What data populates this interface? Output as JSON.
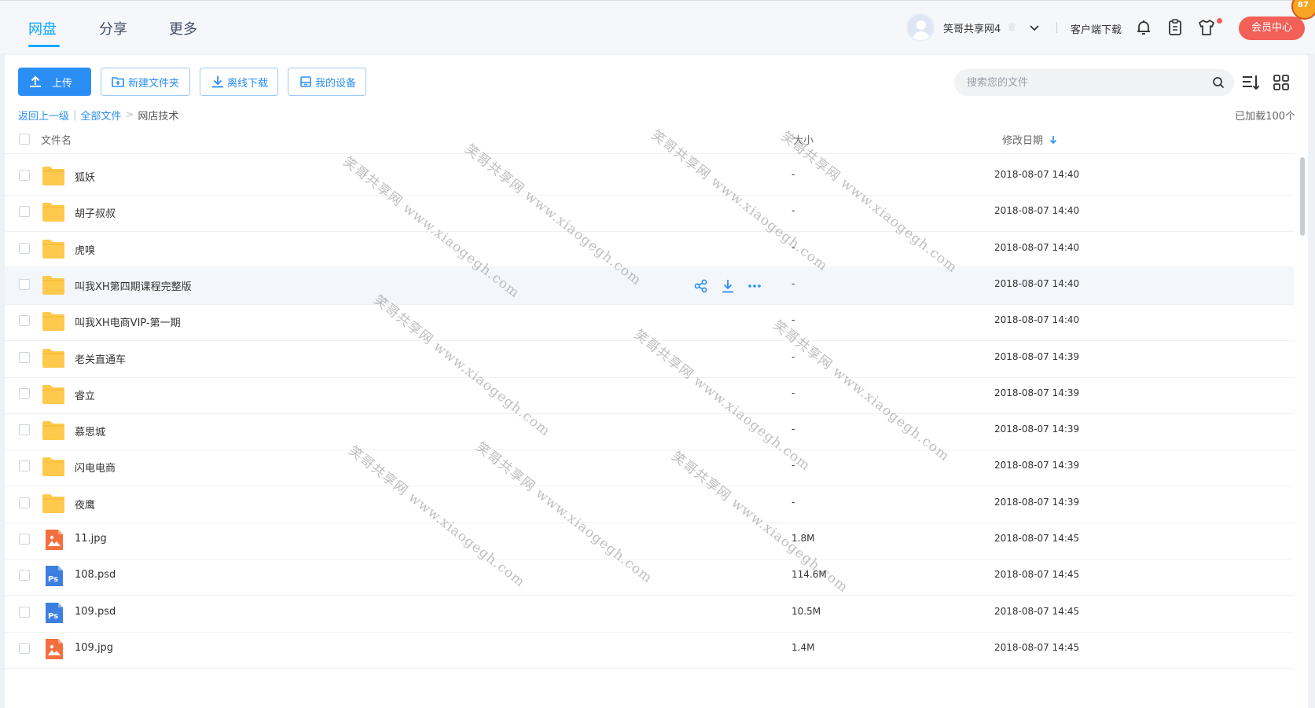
{
  "nav": {
    "tabs": [
      {
        "label": "网盘",
        "active": true
      },
      {
        "label": "分享",
        "active": false
      },
      {
        "label": "更多",
        "active": false
      }
    ]
  },
  "user": {
    "name": "笑哥共享网4",
    "client_download": "客户端下载",
    "vip_center": "会员中心",
    "badge": "87"
  },
  "toolbar": {
    "upload": "上传",
    "new_folder": "新建文件夹",
    "offline_download": "离线下载",
    "my_devices": "我的设备",
    "search_placeholder": "搜索您的文件"
  },
  "breadcrumb": {
    "back": "返回上一级",
    "all_files": "全部文件",
    "current": "网店技术",
    "loaded": "已加载100个"
  },
  "columns": {
    "name": "文件名",
    "size": "大小",
    "modified": "修改日期"
  },
  "files": [
    {
      "name": "狐妖",
      "type": "folder",
      "size": "-",
      "date": "2018-08-07 14:40"
    },
    {
      "name": "胡子叔叔",
      "type": "folder",
      "size": "-",
      "date": "2018-08-07 14:40"
    },
    {
      "name": "虎嗅",
      "type": "folder",
      "size": "-",
      "date": "2018-08-07 14:40"
    },
    {
      "name": "叫我XH第四期课程完整版",
      "type": "folder",
      "size": "-",
      "date": "2018-08-07 14:40",
      "hover": true
    },
    {
      "name": "叫我XH电商VIP-第一期",
      "type": "folder",
      "size": "-",
      "date": "2018-08-07 14:40"
    },
    {
      "name": "老关直通车",
      "type": "folder",
      "size": "-",
      "date": "2018-08-07 14:39"
    },
    {
      "name": "睿立",
      "type": "folder",
      "size": "-",
      "date": "2018-08-07 14:39"
    },
    {
      "name": "慕思城",
      "type": "folder",
      "size": "-",
      "date": "2018-08-07 14:39"
    },
    {
      "name": "闪电电商",
      "type": "folder",
      "size": "-",
      "date": "2018-08-07 14:39"
    },
    {
      "name": "夜鹰",
      "type": "folder",
      "size": "-",
      "date": "2018-08-07 14:39"
    },
    {
      "name": "11.jpg",
      "type": "image",
      "size": "1.8M",
      "date": "2018-08-07 14:45"
    },
    {
      "name": "108.psd",
      "type": "psd",
      "size": "114.6M",
      "date": "2018-08-07 14:45"
    },
    {
      "name": "109.psd",
      "type": "psd",
      "size": "10.5M",
      "date": "2018-08-07 14:45"
    },
    {
      "name": "109.jpg",
      "type": "image",
      "size": "1.4M",
      "date": "2018-08-07 14:45"
    }
  ],
  "watermark": "笑哥共享网 www.xiaogegh.com",
  "colors": {
    "accent": "#06a7ff",
    "primary_button": "#2b8ef5",
    "vip_button": "#f26058",
    "folder": "#ffc94d"
  }
}
